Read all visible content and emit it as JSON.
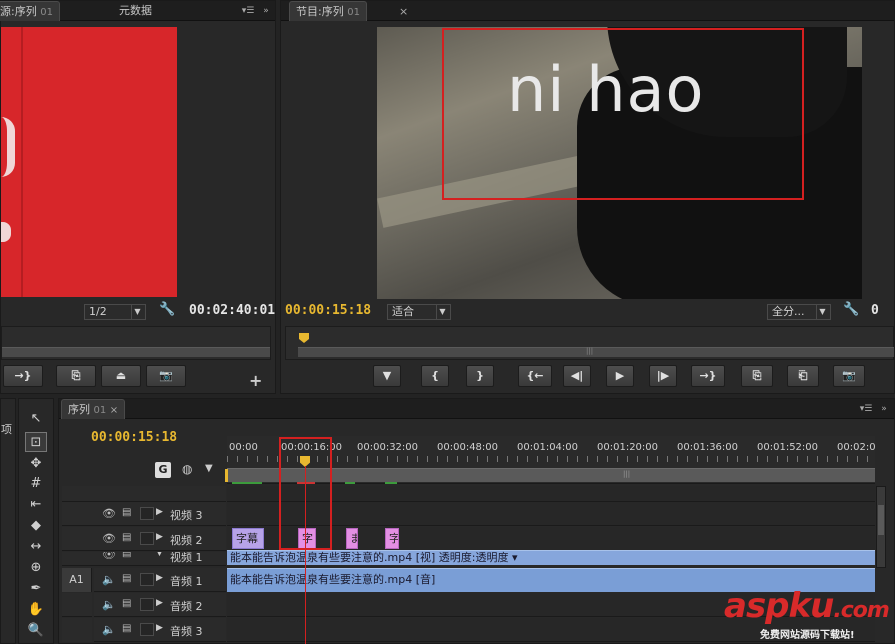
{
  "source_monitor": {
    "tab_label": "源:序列",
    "tab_seq": "01",
    "tab_meta": "元数据",
    "scale": "1/2",
    "duration": "00:02:40:01"
  },
  "program_monitor": {
    "tab_label": "节目:序列",
    "tab_seq": "01",
    "overlay_text": "ni hao",
    "timecode": "00:00:15:18",
    "fit": "适合",
    "quality": "全分...",
    "close_glyph": "×"
  },
  "timeline": {
    "tab_label": "序列",
    "tab_seq": "01",
    "timecode": "00:00:15:18",
    "ruler_labels": [
      "00:00",
      "00:00:16:00",
      "00:00:32:00",
      "00:00:48:00",
      "00:01:04:00",
      "00:01:20:00",
      "00:01:36:00",
      "00:01:52:00",
      "00:02:0"
    ],
    "tracks": {
      "v3": "视频 3",
      "v2": "视频 2",
      "v1": "视频 1",
      "a1": "音频 1",
      "a2": "音频 2",
      "a3": "音频 3",
      "a1_target": "A1"
    },
    "title_clips": [
      "字幕",
      "字",
      "ま",
      "字"
    ],
    "video_clip": "能本能告诉泡温泉有些要注意的.mp4 [视] 透明度:透明度 ▾",
    "audio_clip": "能本能告诉泡温泉有些要注意的.mp4 [音]"
  },
  "left_panel": {
    "label": "项"
  },
  "watermark": {
    "brand": "aspku",
    "suffix": ".com",
    "sub": "免费网站源码下载站!"
  },
  "colors": {
    "accent_timecode": "#e8b830",
    "annotation_red": "#d42020",
    "clip_blue": "#86a6dc",
    "clip_title": "#b7a3e8"
  }
}
